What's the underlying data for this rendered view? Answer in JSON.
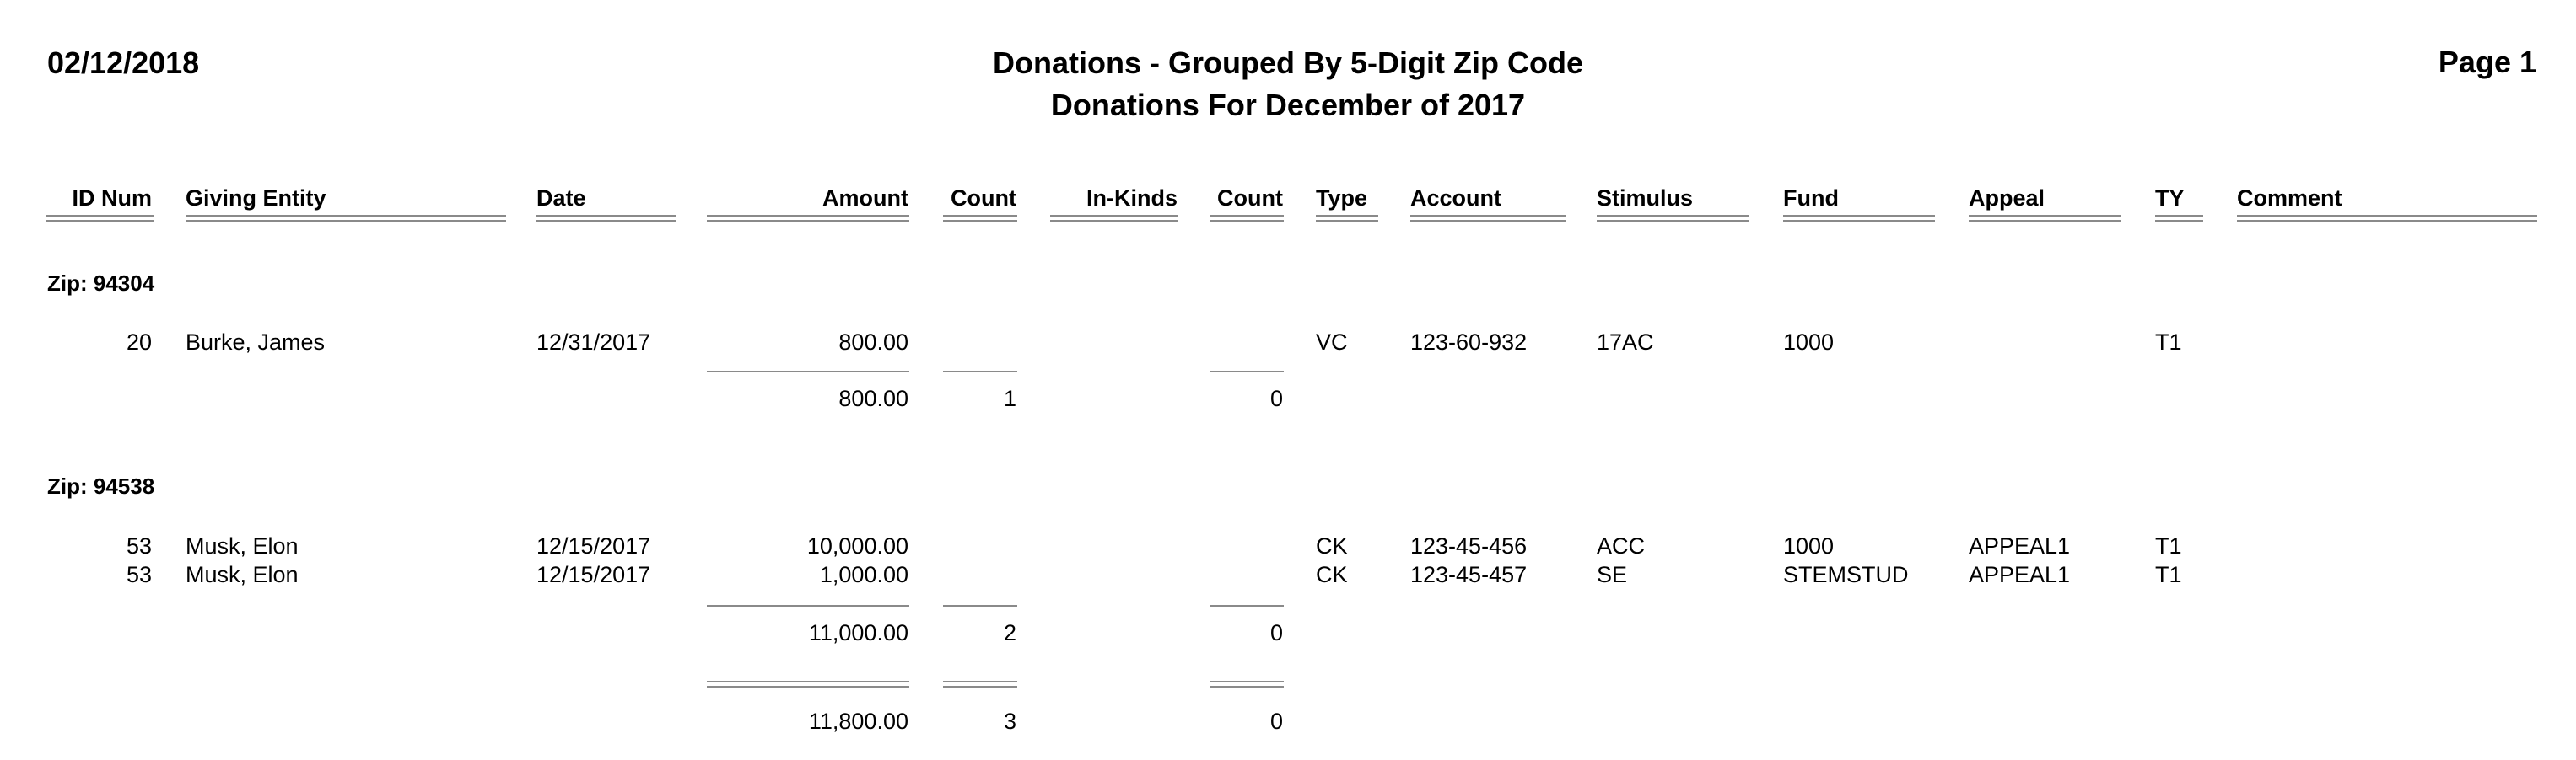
{
  "report": {
    "print_date": "02/12/2018",
    "title": "Donations - Grouped By 5-Digit Zip Code",
    "subtitle": "Donations For December of 2017",
    "page_label": "Page 1"
  },
  "columns": {
    "id_num": "ID Num",
    "giving_entity": "Giving Entity",
    "date": "Date",
    "amount": "Amount",
    "count": "Count",
    "in_kinds": "In-Kinds",
    "count_in_kinds": "Count",
    "type": "Type",
    "account": "Account",
    "stimulus": "Stimulus",
    "fund": "Fund",
    "appeal": "Appeal",
    "ty": "TY",
    "comment": "Comment"
  },
  "groups": [
    {
      "label": "Zip: 94304",
      "rows": [
        {
          "id_num": "20",
          "giving_entity": "Burke, James",
          "date": "12/31/2017",
          "amount": "800.00",
          "count": "",
          "in_kinds": "",
          "count_in_kinds": "",
          "type": "VC",
          "account": "123-60-932",
          "stimulus": "17AC",
          "fund": "1000",
          "appeal": "",
          "ty": "T1",
          "comment": ""
        }
      ],
      "subtotal": {
        "amount": "800.00",
        "count": "1",
        "count_in_kinds": "0"
      }
    },
    {
      "label": "Zip: 94538",
      "rows": [
        {
          "id_num": "53",
          "giving_entity": "Musk, Elon",
          "date": "12/15/2017",
          "amount": "10,000.00",
          "count": "",
          "in_kinds": "",
          "count_in_kinds": "",
          "type": "CK",
          "account": "123-45-456",
          "stimulus": "ACC",
          "fund": "1000",
          "appeal": "APPEAL1",
          "ty": "T1",
          "comment": ""
        },
        {
          "id_num": "53",
          "giving_entity": "Musk, Elon",
          "date": "12/15/2017",
          "amount": "1,000.00",
          "count": "",
          "in_kinds": "",
          "count_in_kinds": "",
          "type": "CK",
          "account": "123-45-457",
          "stimulus": "SE",
          "fund": "STEMSTUD",
          "appeal": "APPEAL1",
          "ty": "T1",
          "comment": ""
        }
      ],
      "subtotal": {
        "amount": "11,000.00",
        "count": "2",
        "count_in_kinds": "0"
      }
    }
  ],
  "grand_total": {
    "amount": "11,800.00",
    "count": "3",
    "count_in_kinds": "0"
  }
}
